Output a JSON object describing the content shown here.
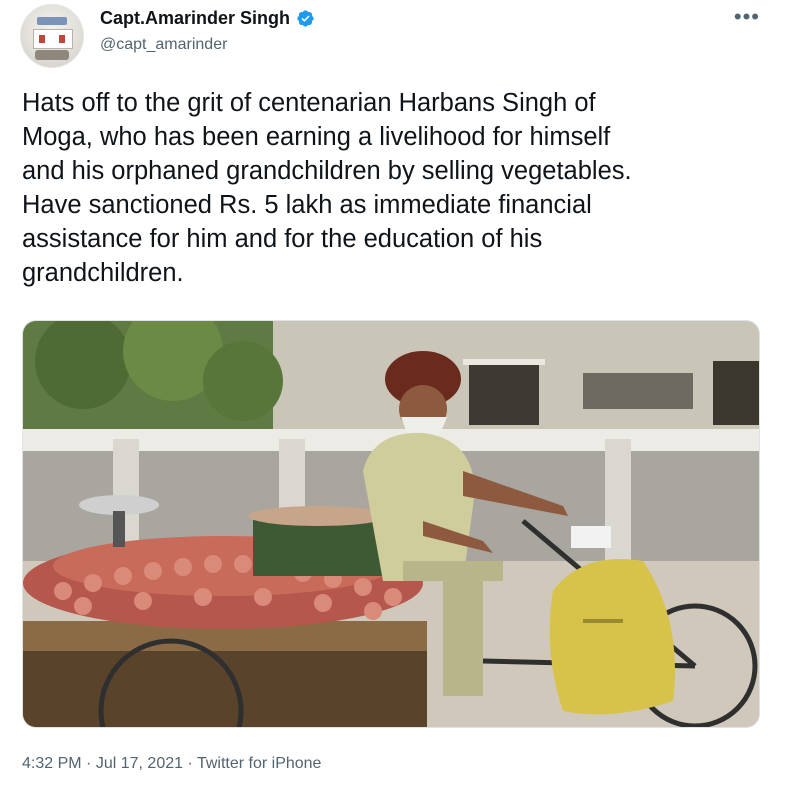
{
  "author": {
    "name": "Capt.Amarinder Singh",
    "handle": "@capt_amarinder",
    "verified": true,
    "verified_color": "#1d9bf0"
  },
  "more_label": "•••",
  "tweet": {
    "text": "Hats off to the grit of centenarian Harbans Singh of\nMoga, who has been earning a livelihood for himself\nand his orphaned grandchildren by selling vegetables.\nHave sanctioned Rs. 5 lakh as immediate financial\nassistance for him and for the education of his\ngrandchildren."
  },
  "meta": {
    "time": "4:32 PM",
    "separator": "·",
    "date": "Jul 17, 2021",
    "source": "Twitter for iPhone"
  }
}
